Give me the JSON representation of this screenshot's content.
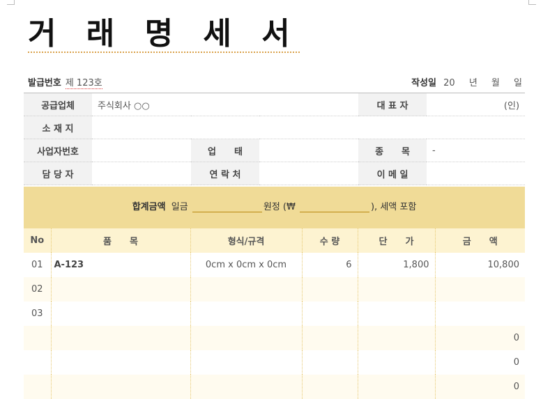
{
  "title": "거 래 명 세 서",
  "issue": {
    "label": "발급번호",
    "value": "제 123호"
  },
  "date": {
    "label": "작성일",
    "year_prefix": "20",
    "year": "년",
    "month": "월",
    "day": "일"
  },
  "info": {
    "supplier_label": "공급업체",
    "supplier_value": "주식회사 ○○",
    "ceo_label": "대 표 자",
    "ceo_value": "(인)",
    "address_label": "소 재 지",
    "bizno_label": "사업자번호",
    "biztype_label": "업　　태",
    "item_label": "종　　목",
    "item_value": "-",
    "manager_label": "담 당 자",
    "contact_label": "연 락 처",
    "email_label": "이 메 일"
  },
  "total": {
    "label": "합계금액",
    "t1": "일금",
    "t2": "원정 (₩",
    "t3": "), 세액 포함"
  },
  "items": {
    "headers": [
      "No",
      "품　　목",
      "형식/규격",
      "수 량",
      "단　　가",
      "금　　액"
    ],
    "rows": [
      {
        "no": "01",
        "name": "A-123",
        "spec": "0cm x 0cm x 0cm",
        "qty": "6",
        "price": "1,800",
        "amount": "10,800"
      },
      {
        "no": "02",
        "name": "",
        "spec": "",
        "qty": "",
        "price": "",
        "amount": ""
      },
      {
        "no": "03",
        "name": "",
        "spec": "",
        "qty": "",
        "price": "",
        "amount": ""
      },
      {
        "no": "",
        "name": "",
        "spec": "",
        "qty": "",
        "price": "",
        "amount": "0"
      },
      {
        "no": "",
        "name": "",
        "spec": "",
        "qty": "",
        "price": "",
        "amount": "0"
      },
      {
        "no": "",
        "name": "",
        "spec": "",
        "qty": "",
        "price": "",
        "amount": "0"
      }
    ]
  }
}
